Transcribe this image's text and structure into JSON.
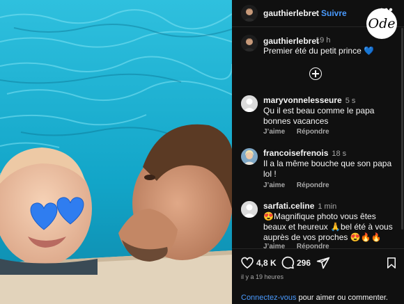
{
  "header": {
    "username": "gauthierlebret",
    "separator": "•",
    "follow_label": "Suivre",
    "more_label": "•••"
  },
  "badge": {
    "text": "Ode"
  },
  "caption": {
    "username": "gauthierlebret",
    "time": "19 h",
    "text": "Premier été du petit prince",
    "emoji": "💙"
  },
  "add_comment_icon": "plus-circle-icon",
  "comments": [
    {
      "username": "maryvonnelesseure",
      "time": "5 s",
      "text": "Qu il est beau comme le papa bonnes vacances",
      "like_label": "J’aime",
      "reply_label": "Répondre"
    },
    {
      "username": "francoisefrenois",
      "time": "18 s",
      "text": "Il a la même bouche que son papa lol !",
      "like_label": "J’aime",
      "reply_label": "Répondre"
    },
    {
      "username": "sarfati.celine",
      "time": "1 min",
      "text": "😍Magnifique photo vous êtes beaux et heureux 🙏bel été à vous auprès de vos proches 😍🔥🔥",
      "like_label": "J’aime",
      "reply_label": "Répondre"
    }
  ],
  "actions": {
    "likes": "4,8 K",
    "comments": "296",
    "icons": [
      "heart-icon",
      "comment-icon",
      "share-icon",
      "bookmark-icon"
    ]
  },
  "time_ago": "il y a 19 heures",
  "login": {
    "link": "Connectez-vous",
    "rest": " pour aimer ou commenter."
  },
  "colors": {
    "accent": "#4a9bff",
    "panel_bg": "#101010",
    "pool": "#1fb0d0"
  }
}
